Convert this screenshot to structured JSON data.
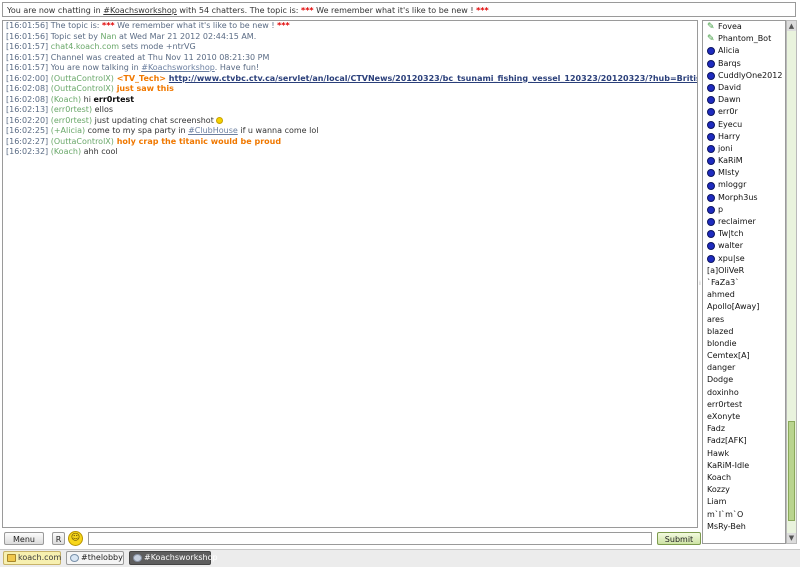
{
  "topic_bar": {
    "prefix": "You are now chatting in ",
    "channel": "#Koachsworkshop",
    "middle": " with 54 chatters. The topic is: ",
    "stars1": "***",
    "topic": "  We remember what it's like to be new ! ",
    "stars2": "***"
  },
  "messages": [
    {
      "ts": "[16:01:56]",
      "parts": [
        {
          "t": " The topic is: ",
          "c": "sys"
        },
        {
          "t": "***",
          "c": "red"
        },
        {
          "t": "  We remember what it's like to be new ! ",
          "c": "sys"
        },
        {
          "t": "***",
          "c": "red"
        }
      ]
    },
    {
      "ts": "[16:01:56]",
      "parts": [
        {
          "t": " Topic set by ",
          "c": "sys"
        },
        {
          "t": "Nan",
          "c": "gnick"
        },
        {
          "t": " at Wed Mar 21 2012 02:44:15 AM.",
          "c": "sys"
        }
      ]
    },
    {
      "ts": "[16:01:57]",
      "parts": [
        {
          "t": " ",
          "c": "sys"
        },
        {
          "t": "chat4.koach.com",
          "c": "gnick"
        },
        {
          "t": " sets mode +ntrVG",
          "c": "sys"
        }
      ]
    },
    {
      "ts": "[16:01:57]",
      "parts": [
        {
          "t": " Channel was created at Thu Nov 11 2010 08:21:30 PM",
          "c": "sys"
        }
      ]
    },
    {
      "ts": "[16:01:57]",
      "parts": [
        {
          "t": " You are now talking in ",
          "c": "sys"
        },
        {
          "t": "#Koachsworkshop",
          "c": "chan"
        },
        {
          "t": ". Have fun!",
          "c": "sys"
        }
      ]
    },
    {
      "ts": "[16:02:00]",
      "parts": [
        {
          "t": " (OuttaControlX)",
          "c": "gnick"
        },
        {
          "t": " <TV_Tech> ",
          "c": "orange"
        },
        {
          "t": "http://www.ctvbc.ctv.ca/servlet/an/local/CTVNews/20120323/bc_tsunami_fishing_vessel_120323/20120323/?hub=BritishColumbiaHome",
          "c": "link"
        }
      ]
    },
    {
      "ts": "[16:02:08]",
      "parts": [
        {
          "t": " (OuttaControlX)",
          "c": "gnick"
        },
        {
          "t": " just saw this",
          "c": "orange"
        }
      ]
    },
    {
      "ts": "[16:02:08]",
      "parts": [
        {
          "t": " (Koach)",
          "c": "gnick"
        },
        {
          "t": " hi ",
          "c": "plain"
        },
        {
          "t": "err0rtest",
          "c": "bnick"
        }
      ]
    },
    {
      "ts": "[16:02:13]",
      "parts": [
        {
          "t": " (err0rtest)",
          "c": "gnick"
        },
        {
          "t": " ellos",
          "c": "plain"
        }
      ]
    },
    {
      "ts": "[16:02:20]",
      "parts": [
        {
          "t": " (err0rtest)",
          "c": "gnick"
        },
        {
          "t": " just updating chat screenshot ",
          "c": "plain"
        }
      ],
      "smiley": true
    },
    {
      "ts": "[16:02:25]",
      "parts": [
        {
          "t": " (+Alicia)",
          "c": "gnick"
        },
        {
          "t": " come to my spa party in ",
          "c": "plain"
        },
        {
          "t": "#ClubHouse",
          "c": "chan"
        },
        {
          "t": " if u wanna come lol",
          "c": "plain"
        }
      ]
    },
    {
      "ts": "[16:02:27]",
      "parts": [
        {
          "t": " (OuttaControlX)",
          "c": "gnick"
        },
        {
          "t": " holy crap the titanic would be proud",
          "c": "orange"
        }
      ]
    },
    {
      "ts": "[16:02:32]",
      "parts": [
        {
          "t": " (Koach)",
          "c": "gnick"
        },
        {
          "t": " ahh cool",
          "c": "plain"
        }
      ]
    }
  ],
  "users": [
    {
      "name": "Fovea",
      "icon": "bot"
    },
    {
      "name": "Phantom_Bot",
      "icon": "bot"
    },
    {
      "name": "Alicia",
      "icon": "op"
    },
    {
      "name": "Barqs",
      "icon": "op"
    },
    {
      "name": "CuddlyOne2012",
      "icon": "op"
    },
    {
      "name": "David",
      "icon": "op"
    },
    {
      "name": "Dawn",
      "icon": "op"
    },
    {
      "name": "err0r",
      "icon": "op"
    },
    {
      "name": "Eyecu",
      "icon": "op"
    },
    {
      "name": "Harry",
      "icon": "op"
    },
    {
      "name": "joni",
      "icon": "op"
    },
    {
      "name": "KaRiM",
      "icon": "op"
    },
    {
      "name": "MIsty",
      "icon": "op"
    },
    {
      "name": "mloggr",
      "icon": "op"
    },
    {
      "name": "Morph3us",
      "icon": "op"
    },
    {
      "name": "p",
      "icon": "op"
    },
    {
      "name": "reclaimer",
      "icon": "op"
    },
    {
      "name": "Tw|tch",
      "icon": "op"
    },
    {
      "name": "walter",
      "icon": "op"
    },
    {
      "name": "xpu|se",
      "icon": "op"
    },
    {
      "name": "[a]OliVeR",
      "icon": "none"
    },
    {
      "name": "`FaZa3`",
      "icon": "none"
    },
    {
      "name": "ahmed",
      "icon": "none"
    },
    {
      "name": "Apollo[Away]",
      "icon": "none"
    },
    {
      "name": "ares",
      "icon": "none"
    },
    {
      "name": "blazed",
      "icon": "none"
    },
    {
      "name": "blondie",
      "icon": "none"
    },
    {
      "name": "Cemtex[A]",
      "icon": "none"
    },
    {
      "name": "danger",
      "icon": "none"
    },
    {
      "name": "Dodge",
      "icon": "none"
    },
    {
      "name": "doxinho",
      "icon": "none"
    },
    {
      "name": "err0rtest",
      "icon": "none"
    },
    {
      "name": "eXonyte",
      "icon": "none"
    },
    {
      "name": "Fadz",
      "icon": "none"
    },
    {
      "name": "Fadz[AFK]",
      "icon": "none"
    },
    {
      "name": "Hawk",
      "icon": "none"
    },
    {
      "name": "KaRiM-Idle",
      "icon": "none"
    },
    {
      "name": "Koach",
      "icon": "none"
    },
    {
      "name": "Kozzy",
      "icon": "none"
    },
    {
      "name": "Liam",
      "icon": "none"
    },
    {
      "name": "m`I`m`O",
      "icon": "none"
    },
    {
      "name": "MsRy-Beh",
      "icon": "none"
    }
  ],
  "controls": {
    "menu_label": "Menu",
    "r_label": "R",
    "smiley_label": "☺",
    "input_value": "",
    "submit_label": "Submit"
  },
  "tabs": [
    {
      "label": "koach.com"
    },
    {
      "label": "#thelobby"
    },
    {
      "label": "#Koachsworkshop"
    }
  ],
  "colors": {
    "accent_green": "#b9d48e",
    "nick_green": "#6aa86a",
    "highlight_orange": "#f07800",
    "topic_red": "#e00000",
    "op_blue": "#1e2bbf"
  }
}
